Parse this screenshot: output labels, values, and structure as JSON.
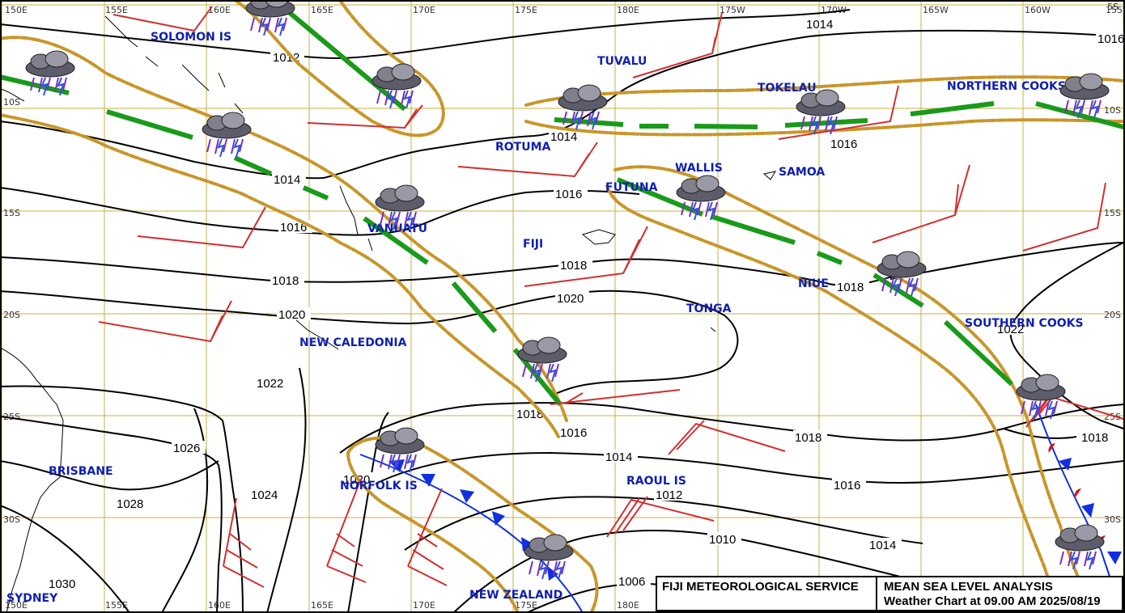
{
  "lon_labels": [
    "150E",
    "155E",
    "160E",
    "165E",
    "170E",
    "175E",
    "180E",
    "175W",
    "170W",
    "165W",
    "160W",
    "155W"
  ],
  "lat_labels": [
    "5S",
    "10S",
    "15S",
    "20S",
    "25S",
    "30S"
  ],
  "places": [
    "SOLOMON IS",
    "TUVALU",
    "TOKELAU",
    "NORTHERN COOKS",
    "ROTUMA",
    "WALLIS",
    "SAMOA",
    "FUTUNA",
    "VANUATU",
    "FIJI",
    "NIUE",
    "TONGA",
    "NEW CALEDONIA",
    "SOUTHERN COOKS",
    "BRISBANE",
    "RAOUL IS",
    "NORFOLK IS",
    "NEW ZEALAND",
    "SYDNEY"
  ],
  "isobar_labels": [
    "1014",
    "1016",
    "1012",
    "1014",
    "1014",
    "1016",
    "1016",
    "1016",
    "1018",
    "1018",
    "1018",
    "1020",
    "1020",
    "1022",
    "1022",
    "1018",
    "1016",
    "1018",
    "1014",
    "1016",
    "1018",
    "1026",
    "1024",
    "1028",
    "1020",
    "1012",
    "1010",
    "1014",
    "1030",
    "1006"
  ],
  "title": {
    "org": "FIJI METEOROLOGICAL SERVICE",
    "product": "MEAN SEA LEVEL ANALYSIS",
    "line2": "Weather Chart at  09.00 AM  2025/08/19"
  },
  "colors": {
    "grid": "#c8b040",
    "isobar": "#000000",
    "wind": "#d03030",
    "cloud": "#c8962a",
    "trough": "#1a9a1a",
    "cold_front": "#1030e0",
    "warm_front": "#e01010",
    "place_text": "#1020b0"
  },
  "icons": [
    "thunderstorm-icon"
  ]
}
